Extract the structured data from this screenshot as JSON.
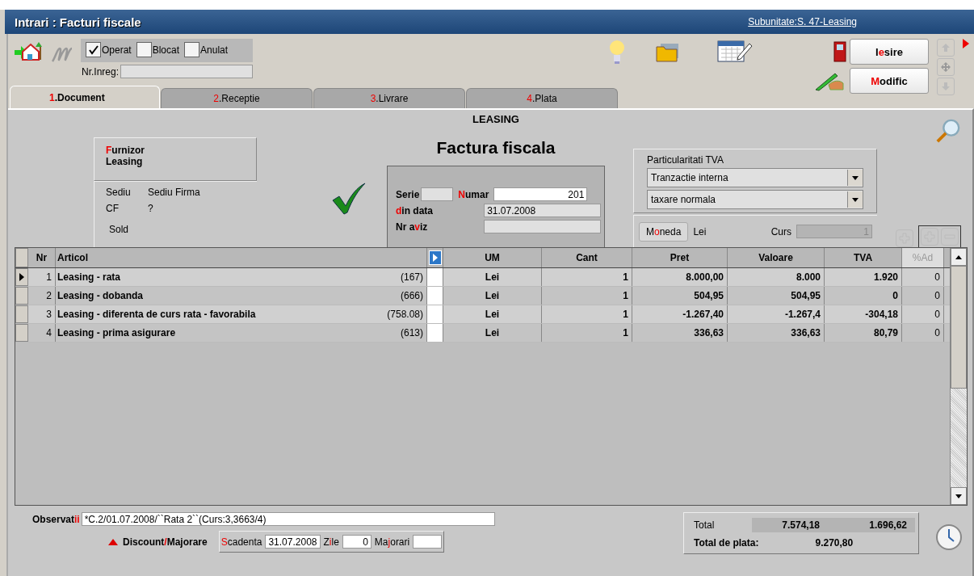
{
  "window": {
    "title": "Intrari : Facturi fiscale",
    "subunit": "Subunitate:S. 47-Leasing"
  },
  "flags": [
    {
      "label": "Operat",
      "checked": true
    },
    {
      "label": "Blocat",
      "checked": false
    },
    {
      "label": "Anulat",
      "checked": false
    }
  ],
  "nr_inreg": {
    "label": "Nr.Inreg:"
  },
  "actions": [
    {
      "label": [
        {
          "text": "I",
          "hot": false
        },
        {
          "text": "e",
          "hot": true
        },
        {
          "text": "sire",
          "hot": false
        }
      ]
    },
    {
      "label": [
        {
          "text": "M",
          "hot": true
        },
        {
          "text": "odific",
          "hot": false
        }
      ]
    }
  ],
  "tabs": [
    {
      "number": "1",
      "label": ".Document",
      "selected": true
    },
    {
      "number": "2",
      "label": ".Receptie",
      "selected": false
    },
    {
      "number": "3",
      "label": ".Livrare",
      "selected": false
    },
    {
      "number": "4",
      "label": ".Plata",
      "selected": false
    }
  ],
  "section_title": "LEASING",
  "document_title": "Factura fiscala",
  "supplier": {
    "label": [
      {
        "text": "F",
        "hot": true
      },
      {
        "text": "urnizor",
        "hot": false
      }
    ],
    "name": "Leasing",
    "fields": [
      {
        "label": "Sediu",
        "value": "Sediu Firma"
      },
      {
        "label": "CF",
        "value": "?"
      },
      {
        "label": "Sold"
      }
    ]
  },
  "invoice": {
    "serie": [
      {
        "text": "Serie",
        "hot": false
      }
    ],
    "numar": [
      {
        "text": "N",
        "hot": true
      },
      {
        "text": "umar",
        "hot": false
      }
    ],
    "numar_value": "201",
    "date": [
      {
        "text": "d",
        "hot": true
      },
      {
        "text": "in data",
        "hot": false
      }
    ],
    "date_value": "31.07.2008",
    "aviz": [
      {
        "text": "Nr a",
        "hot": false
      },
      {
        "text": "v",
        "hot": true
      },
      {
        "text": "iz",
        "hot": false
      }
    ]
  },
  "tva": {
    "title": "Particularitati TVA",
    "options": [
      "Tranzactie interna",
      "taxare normala"
    ]
  },
  "currency": {
    "button": [
      {
        "text": "M",
        "hot": false
      },
      {
        "text": "o",
        "hot": true
      },
      {
        "text": "neda",
        "hot": false
      }
    ],
    "value": "Lei",
    "curs_label": "Curs",
    "curs_value": "1"
  },
  "table": {
    "columns": [
      "Nr",
      "Articol",
      "UM",
      "Cant",
      "Pret",
      "Valoare",
      "TVA",
      "%Ad"
    ],
    "rows": [
      {
        "selected": true,
        "nr": "1",
        "articol": "Leasing - rata",
        "code": "(167)",
        "um": "Lei",
        "cant": "1",
        "pret": "8.000,00",
        "valoare": "8.000",
        "tva": "1.920",
        "ad": "0"
      },
      {
        "selected": false,
        "nr": "2",
        "articol": "Leasing - dobanda",
        "code": "(666)",
        "um": "Lei",
        "cant": "1",
        "pret": "504,95",
        "valoare": "504,95",
        "tva": "0",
        "ad": "0"
      },
      {
        "selected": false,
        "nr": "3",
        "articol": "Leasing - diferenta de curs rata - favorabila",
        "code": "(758.08)",
        "um": "Lei",
        "cant": "1",
        "pret": "-1.267,40",
        "valoare": "-1.267,4",
        "tva": "-304,18",
        "ad": "0"
      },
      {
        "selected": false,
        "nr": "4",
        "articol": "Leasing - prima asigurare",
        "code": "(613)",
        "um": "Lei",
        "cant": "1",
        "pret": "336,63",
        "valoare": "336,63",
        "tva": "80,79",
        "ad": "0"
      }
    ]
  },
  "footer": {
    "obs_label": [
      {
        "text": "Observat",
        "hot": false
      },
      {
        "text": "ii",
        "hot": true
      }
    ],
    "obs_value": "*C.2/01.07.2008/``Rata 2``(Curs:3,3663/4)",
    "discount": [
      {
        "text": "Discount",
        "hot": false
      },
      {
        "text": "/",
        "hot": true
      },
      {
        "text": "Majorare",
        "hot": false
      }
    ],
    "scadenta": [
      {
        "text": "S",
        "hot": true
      },
      {
        "text": "cadenta",
        "hot": false
      }
    ],
    "scadenta_value": "31.07.2008",
    "zile": [
      {
        "text": "Z",
        "hot": false
      },
      {
        "text": "i",
        "hot": true
      },
      {
        "text": "le",
        "hot": false
      }
    ],
    "zile_value": "0",
    "majorari": [
      {
        "text": "Ma",
        "hot": false
      },
      {
        "text": "j",
        "hot": true
      },
      {
        "text": "orari",
        "hot": false
      }
    ]
  },
  "totals": {
    "total_label": "Total",
    "total_value": "7.574,18",
    "total_tva": "1.696,62",
    "payable_label": "Total de plata:",
    "payable_value": "9.270,80"
  }
}
